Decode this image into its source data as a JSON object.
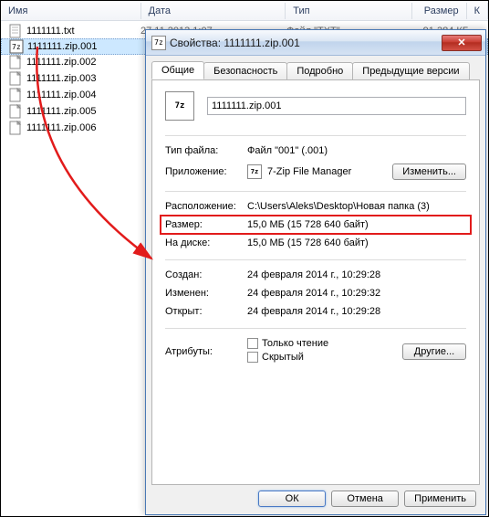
{
  "columns": {
    "name": "Имя",
    "date": "Дата",
    "type": "Тип",
    "size": "Размер",
    "k": "К"
  },
  "files": [
    {
      "icon": "txt",
      "name": "1111111.txt",
      "date": "27.11.2013 1:07",
      "type": "Файл \"TXT\"",
      "size": "91 384 КБ",
      "selected": false
    },
    {
      "icon": "7z",
      "name": "1111111.zip.001",
      "date": "",
      "type": "",
      "size": "",
      "selected": true
    },
    {
      "icon": "blank",
      "name": "1111111.zip.002",
      "date": "",
      "type": "",
      "size": "",
      "selected": false
    },
    {
      "icon": "blank",
      "name": "1111111.zip.003",
      "date": "",
      "type": "",
      "size": "",
      "selected": false
    },
    {
      "icon": "blank",
      "name": "1111111.zip.004",
      "date": "",
      "type": "",
      "size": "",
      "selected": false
    },
    {
      "icon": "blank",
      "name": "1111111.zip.005",
      "date": "",
      "type": "",
      "size": "",
      "selected": false
    },
    {
      "icon": "blank",
      "name": "1111111.zip.006",
      "date": "",
      "type": "",
      "size": "",
      "selected": false
    }
  ],
  "dialog": {
    "title": "Свойства: 1111111.zip.001",
    "tabs": {
      "general": "Общие",
      "security": "Безопасность",
      "details": "Подробно",
      "previous": "Предыдущие версии"
    },
    "filename": "1111111.zip.001",
    "filetype_label": "Тип файла:",
    "filetype_value": "Файл \"001\" (.001)",
    "app_label": "Приложение:",
    "app_value": "7-Zip File Manager",
    "change_btn": "Изменить...",
    "location_label": "Расположение:",
    "location_value": "C:\\Users\\Aleks\\Desktop\\Новая папка (3)",
    "size_label": "Размер:",
    "size_value": "15,0 МБ (15 728 640 байт)",
    "ondisk_label": "На диске:",
    "ondisk_value": "15,0 МБ (15 728 640 байт)",
    "created_label": "Создан:",
    "created_value": "24 февраля 2014 г., 10:29:28",
    "modified_label": "Изменен:",
    "modified_value": "24 февраля 2014 г., 10:29:32",
    "accessed_label": "Открыт:",
    "accessed_value": "24 февраля 2014 г., 10:29:28",
    "attributes_label": "Атрибуты:",
    "readonly": "Только чтение",
    "hidden": "Скрытый",
    "other_btn": "Другие...",
    "ok": "ОК",
    "cancel": "Отмена",
    "apply": "Применить"
  }
}
